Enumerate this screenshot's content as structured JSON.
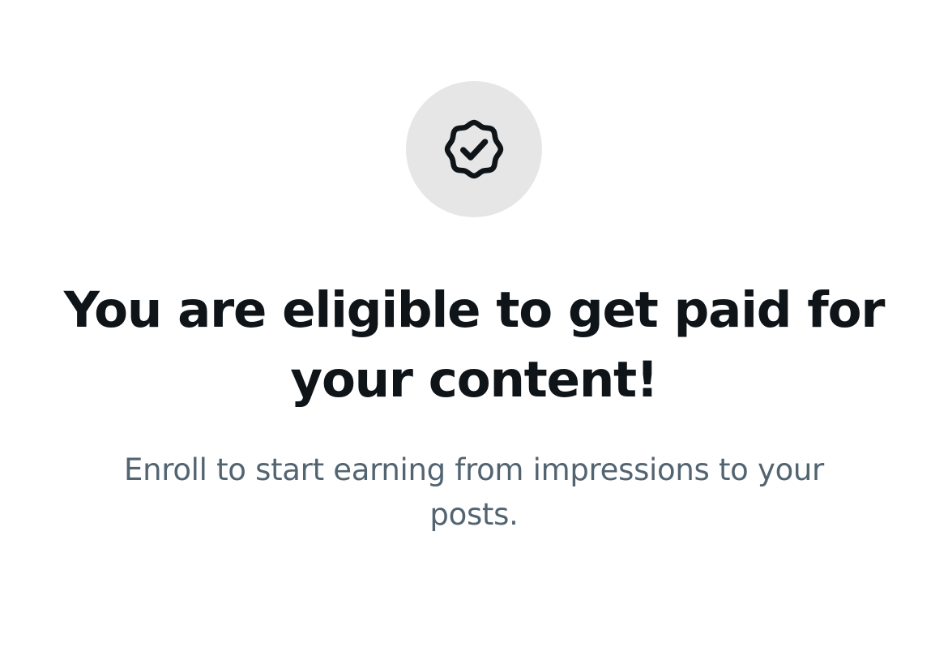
{
  "status_icon": {
    "name": "verified-badge-check-icon",
    "circle_color": "#e6e6e6",
    "icon_color": "#0f1419"
  },
  "headline": "You are eligible to get paid for your content!",
  "subtext": "Enroll to start earning from impressions to your posts.",
  "colors": {
    "headline": "#0f1419",
    "subtext": "#536471",
    "background": "#ffffff"
  }
}
